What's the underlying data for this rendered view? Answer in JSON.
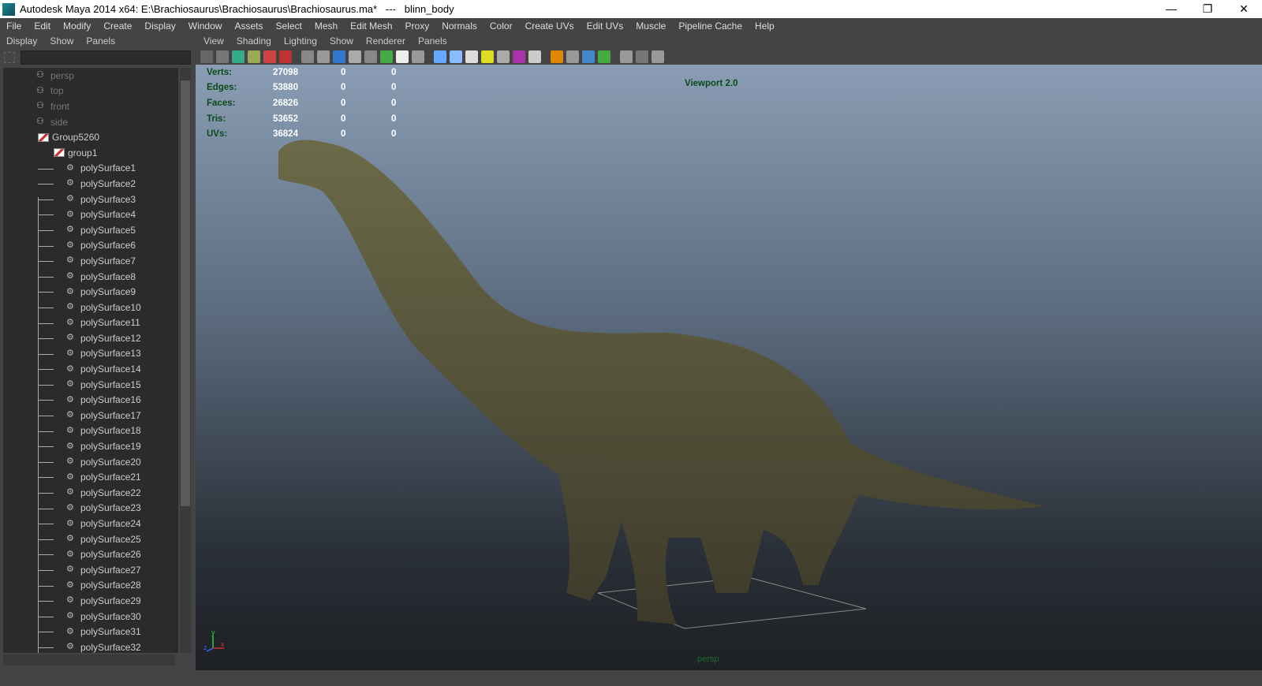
{
  "window": {
    "title": "Autodesk Maya 2014 x64: E:\\Brachiosaurus\\Brachiosaurus\\Brachiosaurus.ma*   ---   blinn_body",
    "minimize": "—",
    "restore": "❐",
    "close": "✕"
  },
  "menubar": [
    "File",
    "Edit",
    "Modify",
    "Create",
    "Display",
    "Window",
    "Assets",
    "Select",
    "Mesh",
    "Edit Mesh",
    "Proxy",
    "Normals",
    "Color",
    "Create UVs",
    "Edit UVs",
    "Muscle",
    "Pipeline Cache",
    "Help"
  ],
  "outliner": {
    "menu": [
      "Display",
      "Show",
      "Panels"
    ],
    "cameras": [
      "persp",
      "top",
      "front",
      "side"
    ],
    "group": "Group5260",
    "subgroup": "group1",
    "items": [
      "polySurface1",
      "polySurface2",
      "polySurface3",
      "polySurface4",
      "polySurface5",
      "polySurface6",
      "polySurface7",
      "polySurface8",
      "polySurface9",
      "polySurface10",
      "polySurface11",
      "polySurface12",
      "polySurface13",
      "polySurface14",
      "polySurface15",
      "polySurface16",
      "polySurface17",
      "polySurface18",
      "polySurface19",
      "polySurface20",
      "polySurface21",
      "polySurface22",
      "polySurface23",
      "polySurface24",
      "polySurface25",
      "polySurface26",
      "polySurface27",
      "polySurface28",
      "polySurface29",
      "polySurface30",
      "polySurface31",
      "polySurface32"
    ]
  },
  "viewport": {
    "menu": [
      "View",
      "Shading",
      "Lighting",
      "Show",
      "Renderer",
      "Panels"
    ],
    "hud": [
      {
        "label": "Verts:",
        "v": "27098",
        "a": "0",
        "b": "0"
      },
      {
        "label": "Edges:",
        "v": "53880",
        "a": "0",
        "b": "0"
      },
      {
        "label": "Faces:",
        "v": "26826",
        "a": "0",
        "b": "0"
      },
      {
        "label": "Tris:",
        "v": "53652",
        "a": "0",
        "b": "0"
      },
      {
        "label": "UVs:",
        "v": "36824",
        "a": "0",
        "b": "0"
      }
    ],
    "renderer": "Viewport 2.0",
    "camera": "persp",
    "axis_y": "y",
    "axis_x": "x",
    "axis_z": "z"
  },
  "toolbar_colors": [
    "#666",
    "#777",
    "#3a8",
    "#9a5",
    "#c44",
    "#b33",
    "#888",
    "#999",
    "#37c",
    "#aaa",
    "#888",
    "#4a4",
    "#eee",
    "#999",
    "#6af",
    "#8bf",
    "#ddd",
    "#dd2",
    "#aaa",
    "#a3a",
    "#ccc",
    "#d80",
    "#999",
    "#48c",
    "#4a4",
    "#999",
    "#777",
    "#999"
  ]
}
